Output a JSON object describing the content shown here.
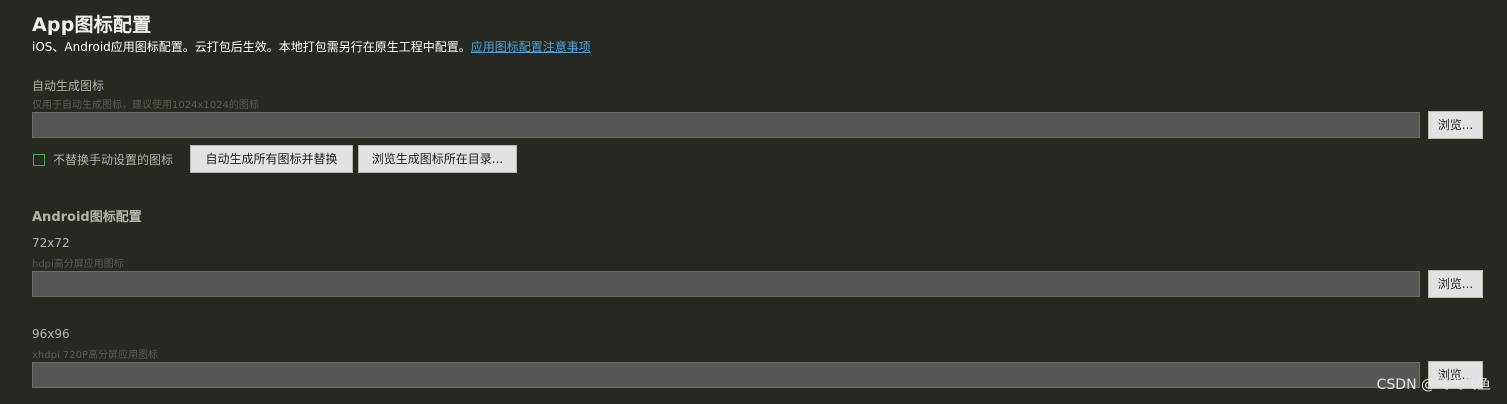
{
  "header": {
    "title": "App图标配置",
    "subtitle": "iOS、Android应用图标配置。云打包后生效。本地打包需另行在原生工程中配置。",
    "link_text": "应用图标配置注意事项"
  },
  "auto_generate": {
    "label": "自动生成图标",
    "hint": "仅用于自动生成图标，建议使用1024x1024的图标",
    "path_value": "",
    "browse_label": "浏览...",
    "checkbox_label": "不替换手动设置的图标",
    "checkbox_checked": false,
    "generate_label": "自动生成所有图标并替换",
    "open_dir_label": "浏览生成图标所在目录..."
  },
  "android": {
    "section_title": "Android图标配置",
    "icons": [
      {
        "size_label": "72x72",
        "hint": "hdpi高分屏应用图标",
        "path_value": "",
        "browse_label": "浏览..."
      },
      {
        "size_label": "96x96",
        "hint": "xhdpi 720P高分屏应用图标",
        "path_value": "",
        "browse_label": "浏览..."
      }
    ]
  },
  "watermark": "CSDN @飞飞飞鱼",
  "colors": {
    "background": "#272822",
    "input_bg": "#565656",
    "link": "#4aa3df",
    "checkbox_border": "#3fae55"
  }
}
